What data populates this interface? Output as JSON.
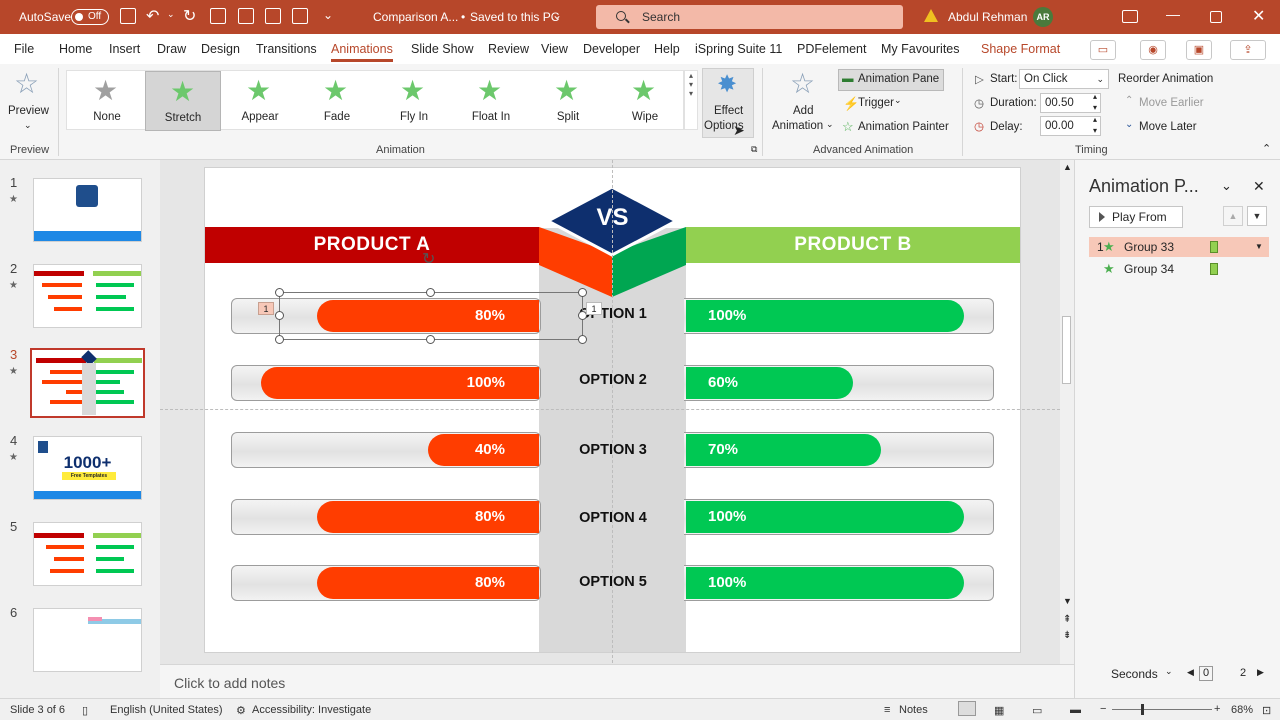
{
  "titlebar": {
    "autosave_label": "AutoSave",
    "autosave_state": "Off",
    "doc_title": "Comparison A...",
    "save_status": "Saved to this PC",
    "search_placeholder": "Search",
    "user_name": "Abdul Rehman",
    "user_initials": "AR"
  },
  "tabs": [
    "File",
    "Home",
    "Insert",
    "Draw",
    "Design",
    "Transitions",
    "Animations",
    "Slide Show",
    "Review",
    "View",
    "Developer",
    "Help",
    "iSpring Suite 11",
    "PDFelement",
    "My Favourites",
    "Shape Format"
  ],
  "ribbon": {
    "preview_label": "Preview",
    "preview_group": "Preview",
    "animations": [
      "None",
      "Stretch",
      "Appear",
      "Fade",
      "Fly In",
      "Float In",
      "Split",
      "Wipe"
    ],
    "selected_animation": "Stretch",
    "effect_options_line1": "Effect",
    "effect_options_line2": "Options",
    "animation_group": "Animation",
    "add_animation_line1": "Add",
    "add_animation_line2": "Animation",
    "animation_pane": "Animation Pane",
    "trigger": "Trigger",
    "animation_painter": "Animation Painter",
    "advanced_group": "Advanced Animation",
    "start_label": "Start:",
    "start_value": "On Click",
    "duration_label": "Duration:",
    "duration_value": "00.50",
    "delay_label": "Delay:",
    "delay_value": "00.00",
    "reorder_label": "Reorder Animation",
    "move_earlier": "Move Earlier",
    "move_later": "Move Later",
    "timing_group": "Timing"
  },
  "slides": [
    {
      "number": "1",
      "active": false
    },
    {
      "number": "2",
      "active": false
    },
    {
      "number": "3",
      "active": true
    },
    {
      "number": "4",
      "active": false,
      "thumb_text": "1000+",
      "thumb_sub": "Free Templates"
    },
    {
      "number": "5",
      "active": false
    },
    {
      "number": "6",
      "active": false
    }
  ],
  "slide": {
    "product_a": "PRODUCT A",
    "product_b": "PRODUCT B",
    "vs": "VS",
    "colors": {
      "red": "#c00000",
      "green": "#92d050",
      "orange": "#ff3d00",
      "bar_green": "#00c853",
      "navy": "#0e2f6e"
    },
    "rows": [
      {
        "option": "OPTION 1",
        "a_label": "80%",
        "a_value": 80,
        "b_label": "100%",
        "b_value": 100
      },
      {
        "option": "OPTION 2",
        "a_label": "100%",
        "a_value": 100,
        "b_label": "60%",
        "b_value": 60
      },
      {
        "option": "OPTION 3",
        "a_label": "40%",
        "a_value": 40,
        "b_label": "70%",
        "b_value": 70
      },
      {
        "option": "OPTION 4",
        "a_label": "80%",
        "a_value": 80,
        "b_label": "100%",
        "b_value": 100
      },
      {
        "option": "OPTION 5",
        "a_label": "80%",
        "a_value": 80,
        "b_label": "100%",
        "b_value": 100
      }
    ],
    "anim_tag_1": "1",
    "anim_tag_2": "1"
  },
  "notes_placeholder": "Click to add notes",
  "anim_pane": {
    "title": "Animation P...",
    "play_from": "Play From",
    "items": [
      {
        "index": "1",
        "name": "Group 33",
        "selected": true
      },
      {
        "index": "",
        "name": "Group 34",
        "selected": false
      }
    ],
    "seconds_label": "Seconds",
    "timeline_start": "0",
    "timeline_end": "2"
  },
  "status": {
    "slide_info": "Slide 3 of 6",
    "language": "English (United States)",
    "accessibility": "Accessibility: Investigate",
    "notes": "Notes",
    "zoom": "68%"
  }
}
